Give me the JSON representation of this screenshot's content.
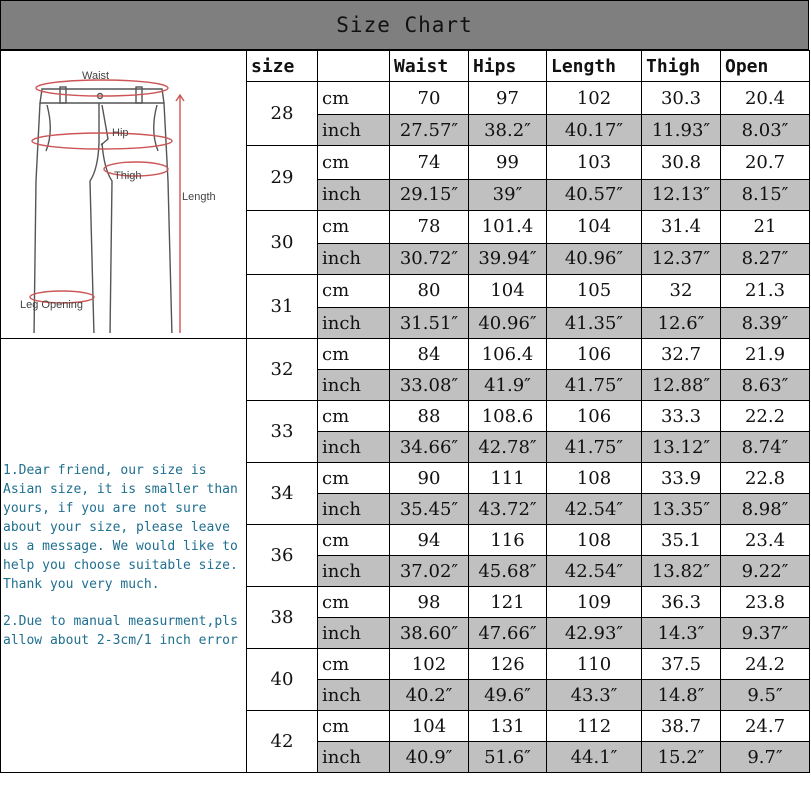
{
  "title": "Size Chart",
  "headers": [
    "size",
    "",
    "Waist",
    "Hips",
    "Length",
    "Thigh",
    "Open"
  ],
  "diagram_labels": {
    "waist": "Waist",
    "hip": "Hip",
    "thigh": "Thigh",
    "length": "Length",
    "leg_opening": "Leg Opening"
  },
  "notes": [
    "1.Dear friend, our size is Asian size, it is smaller than yours, if you are not sure about your size, please leave us a message. We would like to help you choose suitable size. Thank you very much.",
    "2.Due to manual measurment,pls allow about 2-3cm/1 inch error"
  ],
  "units": {
    "cm": "cm",
    "inch": "inch"
  },
  "rows": [
    {
      "size": "28",
      "cm": [
        "70",
        "97",
        "102",
        "30.3",
        "20.4"
      ],
      "inch": [
        "27.57″",
        "38.2″",
        "40.17″",
        "11.93″",
        "8.03″"
      ]
    },
    {
      "size": "29",
      "cm": [
        "74",
        "99",
        "103",
        "30.8",
        "20.7"
      ],
      "inch": [
        "29.15″",
        "39″",
        "40.57″",
        "12.13″",
        "8.15″"
      ]
    },
    {
      "size": "30",
      "cm": [
        "78",
        "101.4",
        "104",
        "31.4",
        "21"
      ],
      "inch": [
        "30.72″",
        "39.94″",
        "40.96″",
        "12.37″",
        "8.27″"
      ]
    },
    {
      "size": "31",
      "cm": [
        "80",
        "104",
        "105",
        "32",
        "21.3"
      ],
      "inch": [
        "31.51″",
        "40.96″",
        "41.35″",
        "12.6″",
        "8.39″"
      ]
    },
    {
      "size": "32",
      "cm": [
        "84",
        "106.4",
        "106",
        "32.7",
        "21.9"
      ],
      "inch": [
        "33.08″",
        "41.9″",
        "41.75″",
        "12.88″",
        "8.63″"
      ]
    },
    {
      "size": "33",
      "cm": [
        "88",
        "108.6",
        "106",
        "33.3",
        "22.2"
      ],
      "inch": [
        "34.66″",
        "42.78″",
        "41.75″",
        "13.12″",
        "8.74″"
      ]
    },
    {
      "size": "34",
      "cm": [
        "90",
        "111",
        "108",
        "33.9",
        "22.8"
      ],
      "inch": [
        "35.45″",
        "43.72″",
        "42.54″",
        "13.35″",
        "8.98″"
      ]
    },
    {
      "size": "36",
      "cm": [
        "94",
        "116",
        "108",
        "35.1",
        "23.4"
      ],
      "inch": [
        "37.02″",
        "45.68″",
        "42.54″",
        "13.82″",
        "9.22″"
      ]
    },
    {
      "size": "38",
      "cm": [
        "98",
        "121",
        "109",
        "36.3",
        "23.8"
      ],
      "inch": [
        "38.60″",
        "47.66″",
        "42.93″",
        "14.3″",
        "9.37″"
      ]
    },
    {
      "size": "40",
      "cm": [
        "102",
        "126",
        "110",
        "37.5",
        "24.2"
      ],
      "inch": [
        "40.2″",
        "49.6″",
        "43.3″",
        "14.8″",
        "9.5″"
      ]
    },
    {
      "size": "42",
      "cm": [
        "104",
        "131",
        "112",
        "38.7",
        "24.7"
      ],
      "inch": [
        "40.9″",
        "51.6″",
        "44.1″",
        "15.2″",
        "9.7″"
      ]
    }
  ]
}
